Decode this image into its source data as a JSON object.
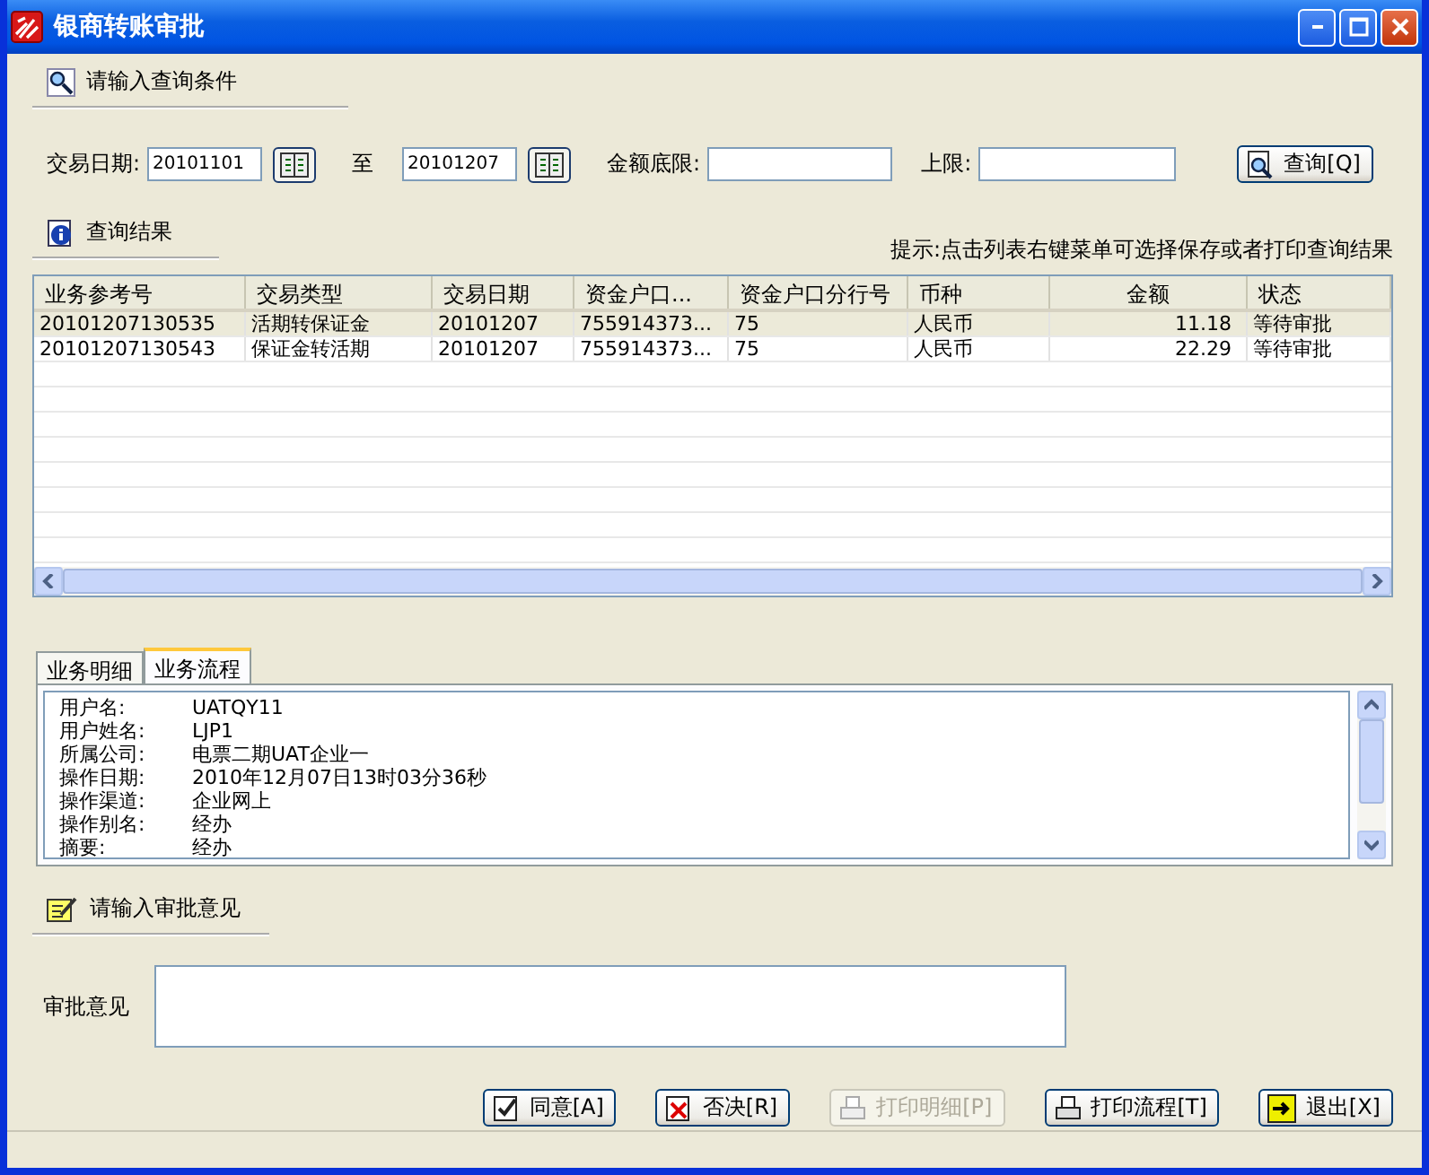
{
  "window": {
    "title": "银商转账审批"
  },
  "query": {
    "heading": "请输入查询条件",
    "date_label": "交易日期:",
    "date_from": "20101101",
    "to_label": "至",
    "date_to": "20101207",
    "min_label": "金额底限:",
    "max_label": "上限:",
    "search_button": "查询[Q]"
  },
  "results": {
    "heading": "查询结果",
    "hint": "提示:点击列表右键菜单可选择保存或者打印查询结果",
    "columns": [
      "业务参考号",
      "交易类型",
      "交易日期",
      "资金户口...",
      "资金户口分行号",
      "币种",
      "金额",
      "状态"
    ],
    "rows": [
      {
        "cells": [
          "20101207130535",
          "活期转保证金",
          "20101207",
          "755914373...",
          "75",
          "人民币",
          "11.18",
          "等待审批"
        ],
        "selected": true
      },
      {
        "cells": [
          "20101207130543",
          "保证金转活期",
          "20101207",
          "755914373...",
          "75",
          "人民币",
          "22.29",
          "等待审批"
        ],
        "selected": false
      }
    ]
  },
  "detail": {
    "tabs": [
      {
        "label": "业务明细",
        "selected": false
      },
      {
        "label": "业务流程",
        "selected": true
      }
    ],
    "fields": [
      {
        "label": "用户名:",
        "value": "UATQY11"
      },
      {
        "label": "用户姓名:",
        "value": "LJP1"
      },
      {
        "label": "所属公司:",
        "value": "电票二期UAT企业一"
      },
      {
        "label": "操作日期:",
        "value": "2010年12月07日13时03分36秒"
      },
      {
        "label": "操作渠道:",
        "value": "企业网上"
      },
      {
        "label": "操作别名:",
        "value": "经办"
      },
      {
        "label": "摘要:",
        "value": "经办"
      }
    ]
  },
  "opinion": {
    "heading": "请输入审批意见",
    "label": "审批意见"
  },
  "buttons": [
    {
      "kind": "approve",
      "label": "同意[A]",
      "disabled": false
    },
    {
      "kind": "reject",
      "label": "否决[R]",
      "disabled": false
    },
    {
      "kind": "print",
      "label": "打印明细[P]",
      "disabled": true
    },
    {
      "kind": "print",
      "label": "打印流程[T]",
      "disabled": false
    },
    {
      "kind": "exit",
      "label": "退出[X]",
      "disabled": false
    }
  ]
}
